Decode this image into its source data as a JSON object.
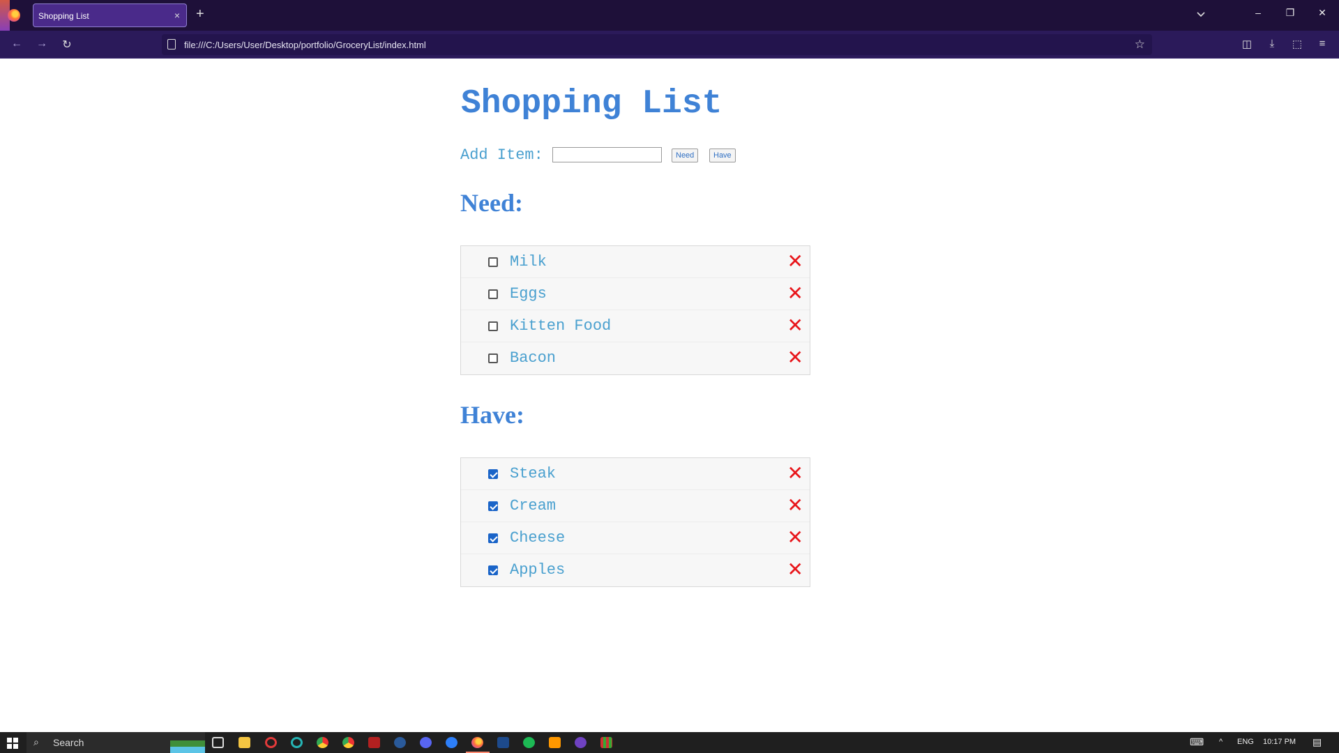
{
  "browser": {
    "tab_title": "Shopping List",
    "tab_close": "×",
    "new_tab": "+",
    "url": "file:///C:/Users/User/Desktop/portfolio/GroceryList/index.html",
    "nav": {
      "back": "←",
      "forward": "→",
      "reload": "↻"
    },
    "window": {
      "minimize": "–",
      "restore": "❐",
      "close": "✕"
    },
    "toolbar": {
      "bookmark": "☆",
      "pocket": "◫",
      "downloads": "⤓",
      "extensions": "⬚",
      "menu": "≡"
    }
  },
  "page": {
    "title": "Shopping List",
    "add_label": "Add Item:",
    "add_input_value": "",
    "need_button": "Need",
    "have_button": "Have",
    "need_heading": "Need:",
    "have_heading": "Have:",
    "delete_glyph": "✕",
    "need_items": [
      {
        "label": "Milk",
        "checked": false
      },
      {
        "label": "Eggs",
        "checked": false
      },
      {
        "label": "Kitten Food",
        "checked": false
      },
      {
        "label": "Bacon",
        "checked": false
      }
    ],
    "have_items": [
      {
        "label": "Steak",
        "checked": true
      },
      {
        "label": "Cream",
        "checked": true
      },
      {
        "label": "Cheese",
        "checked": true
      },
      {
        "label": "Apples",
        "checked": true
      }
    ]
  },
  "taskbar": {
    "search_placeholder": "Search",
    "language": "ENG",
    "time": "10:17 PM"
  },
  "colors": {
    "accent": "#3f82d6",
    "item_text": "#4aa0cf",
    "delete": "#e8161b",
    "checkbox_checked": "#1a64c8",
    "browser_bg": "#1e1039"
  }
}
